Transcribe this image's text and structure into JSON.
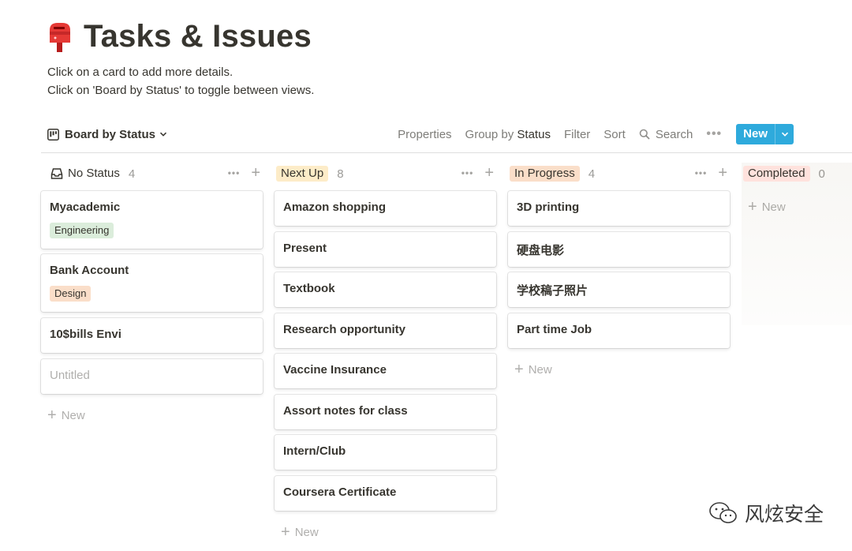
{
  "page": {
    "icon": "postbox-icon",
    "title": "Tasks & Issues",
    "desc_line1": "Click on a card to add more details.",
    "desc_line2": "Click on 'Board by Status' to toggle between views."
  },
  "toolbar": {
    "view_label": "Board by Status",
    "properties": "Properties",
    "group_by_prefix": "Group by",
    "group_by_value": "Status",
    "filter": "Filter",
    "sort": "Sort",
    "search": "Search",
    "more": "•••",
    "new": "New",
    "accent": "#2eaadc"
  },
  "board": {
    "columns": [
      {
        "label": "No Status",
        "count": "4",
        "tag_bg": "transparent",
        "cards": [
          {
            "title": "Myacademic",
            "prop": "Engineering",
            "prop_bg": "#dbeddb"
          },
          {
            "title": "Bank Account",
            "prop": "Design",
            "prop_bg": "#fadec9"
          },
          {
            "title": "10$bills Envi"
          },
          {
            "title": "Untitled",
            "placeholder": true
          }
        ],
        "new": "New"
      },
      {
        "label": "Next Up",
        "count": "8",
        "tag_bg": "#fdecc8",
        "cards": [
          {
            "title": "Amazon shopping"
          },
          {
            "title": "Present"
          },
          {
            "title": "Textbook"
          },
          {
            "title": "Research opportunity"
          },
          {
            "title": "Vaccine Insurance"
          },
          {
            "title": "Assort notes for class"
          },
          {
            "title": "Intern/Club"
          },
          {
            "title": "Coursera Certificate"
          }
        ],
        "new": "New"
      },
      {
        "label": "In Progress",
        "count": "4",
        "tag_bg": "#fadec9",
        "cards": [
          {
            "title": "3D printing"
          },
          {
            "title": "硬盘电影"
          },
          {
            "title": "学校稿子照片"
          },
          {
            "title": "Part time Job"
          }
        ],
        "new": "New"
      },
      {
        "label": "Completed",
        "count": "0",
        "tag_bg": "#ffe2dd",
        "cards": [],
        "new": "New"
      }
    ]
  },
  "watermark": {
    "text": "风炫安全",
    "icon": "wechat-icon"
  }
}
